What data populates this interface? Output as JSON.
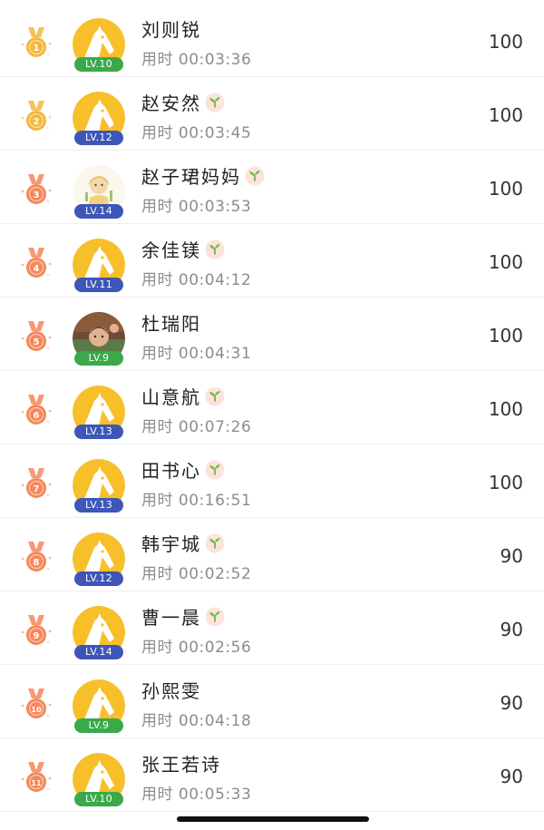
{
  "colors": {
    "medal_gold": "#f5b73b",
    "medal_orange": "#f5875a",
    "level_green": "#3aa94a",
    "level_blue": "#3d56b8",
    "avatar_yellow": "#f7bf2a"
  },
  "rows": [
    {
      "rank": "1",
      "level": "LV.10",
      "level_color": "green",
      "name": "刘则锐",
      "sprout": false,
      "time": "用时 00:03:36",
      "score": "100",
      "avatar": "horse",
      "medal": "gold"
    },
    {
      "rank": "2",
      "level": "LV.12",
      "level_color": "blue",
      "name": "赵安然",
      "sprout": true,
      "time": "用时 00:03:45",
      "score": "100",
      "avatar": "horse",
      "medal": "gold"
    },
    {
      "rank": "3",
      "level": "LV.14",
      "level_color": "blue",
      "name": "赵子珺妈妈",
      "sprout": true,
      "time": "用时 00:03:53",
      "score": "100",
      "avatar": "cartoon",
      "medal": "orange"
    },
    {
      "rank": "4",
      "level": "LV.11",
      "level_color": "blue",
      "name": "余佳镁",
      "sprout": true,
      "time": "用时 00:04:12",
      "score": "100",
      "avatar": "horse",
      "medal": "orange"
    },
    {
      "rank": "5",
      "level": "LV.9",
      "level_color": "green",
      "name": "杜瑞阳",
      "sprout": false,
      "time": "用时 00:04:31",
      "score": "100",
      "avatar": "photo",
      "medal": "orange"
    },
    {
      "rank": "6",
      "level": "LV.13",
      "level_color": "blue",
      "name": "山意航",
      "sprout": true,
      "time": "用时 00:07:26",
      "score": "100",
      "avatar": "horse",
      "medal": "orange"
    },
    {
      "rank": "7",
      "level": "LV.13",
      "level_color": "blue",
      "name": "田书心",
      "sprout": true,
      "time": "用时 00:16:51",
      "score": "100",
      "avatar": "horse",
      "medal": "orange"
    },
    {
      "rank": "8",
      "level": "LV.12",
      "level_color": "blue",
      "name": "韩宇城",
      "sprout": true,
      "time": "用时 00:02:52",
      "score": "90",
      "avatar": "horse",
      "medal": "orange"
    },
    {
      "rank": "9",
      "level": "LV.14",
      "level_color": "blue",
      "name": "曹一晨",
      "sprout": true,
      "time": "用时 00:02:56",
      "score": "90",
      "avatar": "horse",
      "medal": "orange"
    },
    {
      "rank": "10",
      "level": "LV.9",
      "level_color": "green",
      "name": "孙熙雯",
      "sprout": false,
      "time": "用时 00:04:18",
      "score": "90",
      "avatar": "horse",
      "medal": "orange"
    },
    {
      "rank": "11",
      "level": "LV.10",
      "level_color": "green",
      "name": "张王若诗",
      "sprout": false,
      "time": "用时 00:05:33",
      "score": "90",
      "avatar": "horse",
      "medal": "orange"
    }
  ]
}
